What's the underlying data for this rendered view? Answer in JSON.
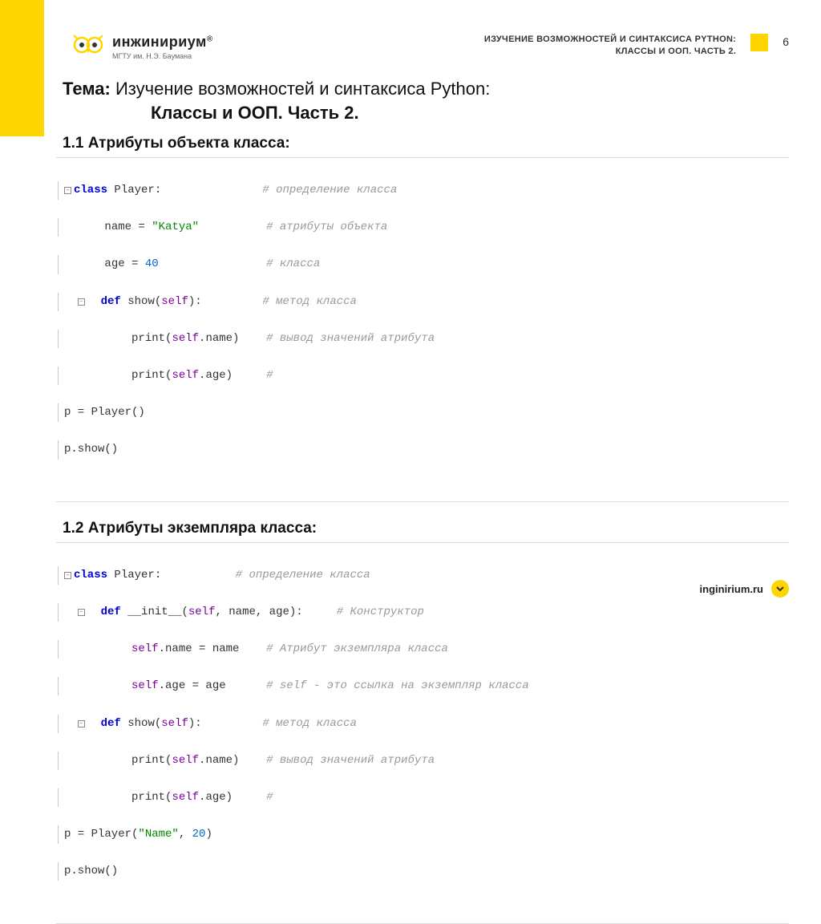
{
  "header": {
    "logo_main": "инжинириум",
    "logo_reg": "®",
    "logo_sub": "МГТУ им. Н.Э. Баумана",
    "title_line1": "ИЗУЧЕНИЕ ВОЗМОЖНОСТЕЙ И СИНТАКСИСА PYTHON:",
    "title_line2": "КЛАССЫ И ООП. ЧАСТЬ 2.",
    "page_number": "6"
  },
  "topic": {
    "label": "Тема:",
    "text": "Изучение возможностей и синтаксиса Python:",
    "subtitle": "Классы и ООП. Часть 2."
  },
  "section1": {
    "heading": "1.1 Атрибуты объекта класса:"
  },
  "section2": {
    "heading": "1.2 Атрибуты экземпляра класса:"
  },
  "footer": {
    "url": "inginirium.ru"
  },
  "code1": {
    "l1_kw": "class",
    "l1_name": " Player:",
    "l1_cm": "# определение класса",
    "l2_a": "name = ",
    "l2_str": "\"Katya\"",
    "l2_cm": "# атрибуты объекта",
    "l3_a": "age = ",
    "l3_num": "40",
    "l3_cm": "# класса",
    "l4_kw": "def",
    "l4_fn": " show(",
    "l4_self": "self",
    "l4_b": "):",
    "l4_cm": "# метод класса",
    "l5_a": "print(",
    "l5_self": "self",
    "l5_b": ".name)",
    "l5_cm": "# вывод значений атрибута",
    "l6_a": "print(",
    "l6_self": "self",
    "l6_b": ".age)",
    "l6_cm": "#",
    "l7": "p = Player()",
    "l8": "p.show()"
  },
  "code2": {
    "l1_kw": "class",
    "l1_name": " Player:",
    "l1_cm": "# определение класса",
    "l2_kw": "def",
    "l2_fn": " __init__(",
    "l2_self": "self",
    "l2_b": ", name, age):",
    "l2_cm": "# Конструктор",
    "l3_self": "self",
    "l3_a": ".name = name",
    "l3_cm": "# Атрибут экземпляра класса",
    "l4_self": "self",
    "l4_a": ".age = age",
    "l4_cm": "# self - это ссылка на экземпляр класса",
    "l5_kw": "def",
    "l5_fn": " show(",
    "l5_self": "self",
    "l5_b": "):",
    "l5_cm": "# метод класса",
    "l6_a": "print(",
    "l6_self": "self",
    "l6_b": ".name)",
    "l6_cm": "# вывод значений атрибута",
    "l7_a": "print(",
    "l7_self": "self",
    "l7_b": ".age)",
    "l7_cm": "#",
    "l8_a": "p = Player(",
    "l8_str": "\"Name\"",
    "l8_b": ", ",
    "l8_num": "20",
    "l8_c": ")",
    "l9": "p.show()"
  }
}
